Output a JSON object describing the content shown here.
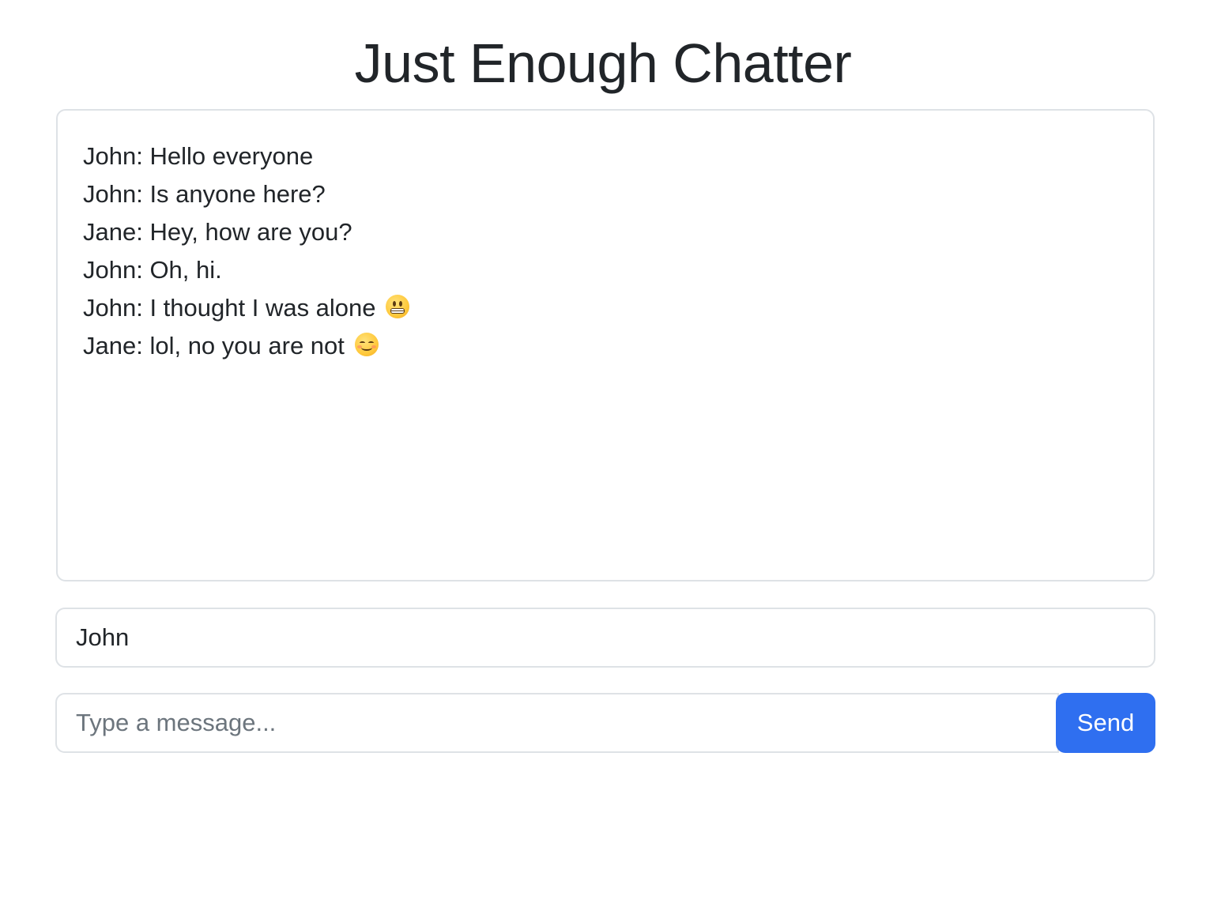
{
  "app": {
    "title": "Just Enough Chatter"
  },
  "chat": {
    "messages": [
      {
        "text": "John: Hello everyone",
        "emoji": ""
      },
      {
        "text": "John: Is anyone here?",
        "emoji": ""
      },
      {
        "text": "Jane: Hey, how are you?",
        "emoji": ""
      },
      {
        "text": "John: Oh, hi.",
        "emoji": ""
      },
      {
        "text": "John: I thought I was alone ",
        "emoji": "grimacing-face-icon"
      },
      {
        "text": "Jane: lol, no you are not ",
        "emoji": "smiling-face-icon"
      }
    ]
  },
  "form": {
    "name_value": "John",
    "message_placeholder": "Type a message...",
    "message_value": "",
    "send_label": "Send"
  },
  "colors": {
    "accent": "#2f6ff0",
    "border": "#dee2e6",
    "text": "#212529",
    "placeholder": "#6c757d"
  }
}
